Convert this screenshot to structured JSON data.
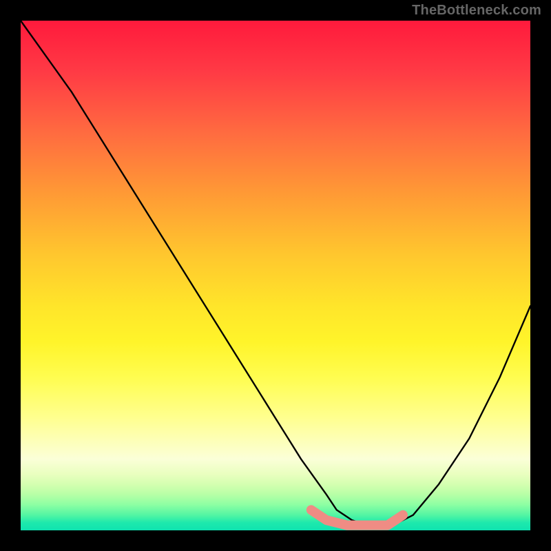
{
  "watermark": "TheBottleneck.com",
  "chart_data": {
    "type": "line",
    "title": "",
    "xlabel": "",
    "ylabel": "",
    "xlim": [
      0,
      100
    ],
    "ylim": [
      0,
      100
    ],
    "series": [
      {
        "name": "curve",
        "color": "#000000",
        "x": [
          0,
          5,
          10,
          15,
          20,
          25,
          30,
          35,
          40,
          45,
          50,
          55,
          60,
          62,
          65,
          68,
          70,
          73,
          77,
          82,
          88,
          94,
          100
        ],
        "values": [
          100,
          93,
          86,
          78,
          70,
          62,
          54,
          46,
          38,
          30,
          22,
          14,
          7,
          4,
          2,
          1,
          1,
          1,
          3,
          9,
          18,
          30,
          44
        ]
      },
      {
        "name": "highlight-band",
        "color": "#ef8c84",
        "x": [
          57,
          60,
          64,
          68,
          72,
          75
        ],
        "values": [
          4,
          2,
          1,
          1,
          1,
          3
        ]
      }
    ],
    "gradient_stops": [
      {
        "pos": 0,
        "color": "#ff1a3c"
      },
      {
        "pos": 50,
        "color": "#ffe52a"
      },
      {
        "pos": 88,
        "color": "#fbffd8"
      },
      {
        "pos": 100,
        "color": "#0fe3b0"
      }
    ]
  }
}
